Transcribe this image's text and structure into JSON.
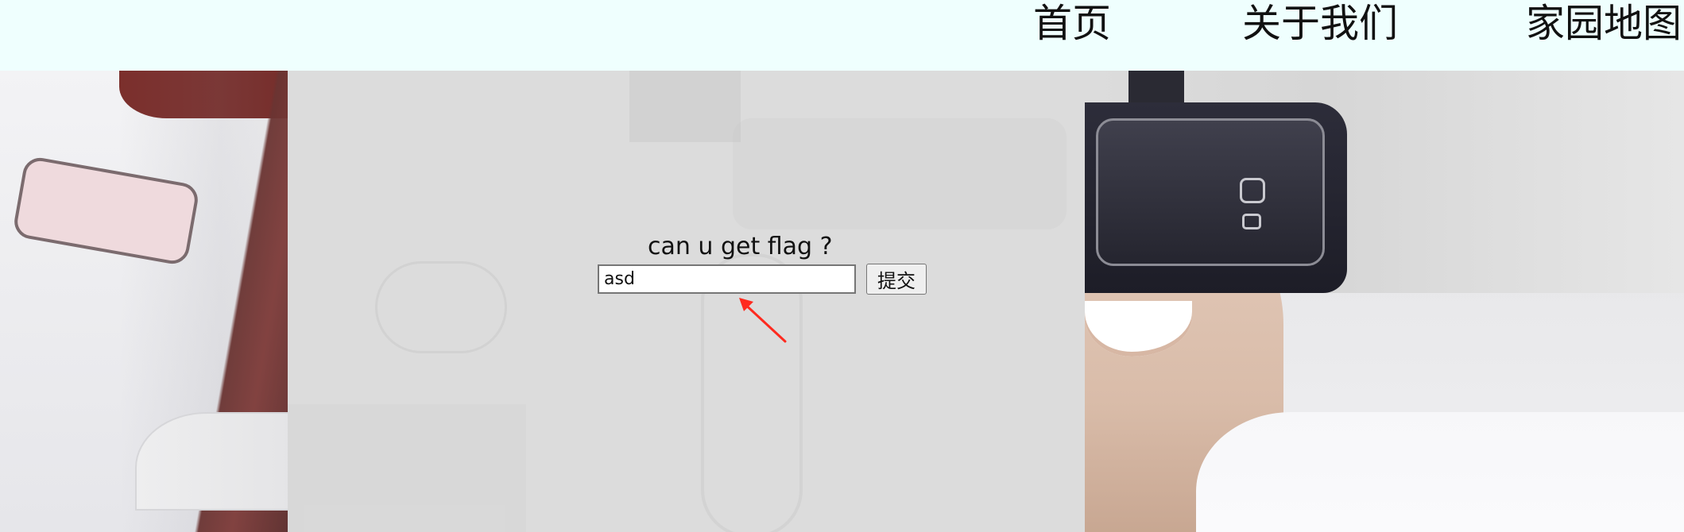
{
  "nav": {
    "items": [
      {
        "label": "首页"
      },
      {
        "label": "关于我们"
      },
      {
        "label": "家园地图"
      }
    ]
  },
  "form": {
    "title": "can u get flag ?",
    "input_value": "asd",
    "submit_label": "提交"
  },
  "colors": {
    "topbar_background": "#effffe",
    "panel_background": "#dcdcdc",
    "annotation_arrow": "#ff0000"
  }
}
